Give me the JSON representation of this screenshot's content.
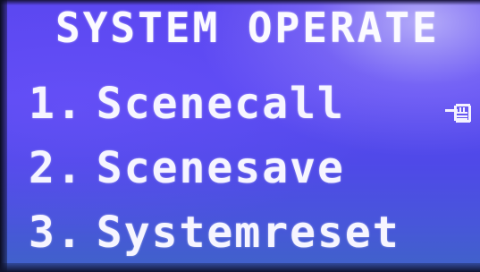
{
  "screen": {
    "title": "SYSTEM OPERATE"
  },
  "menu": {
    "items": [
      {
        "number": "1.",
        "label": "Scenecall"
      },
      {
        "number": "2.",
        "label": "Scenesave"
      },
      {
        "number": "3.",
        "label": "Systemreset"
      }
    ],
    "selected_index": 0,
    "cursor_icon": "pointing-hand-icon"
  },
  "colors": {
    "background": "#5a49f2",
    "text": "#f4f2ff"
  }
}
